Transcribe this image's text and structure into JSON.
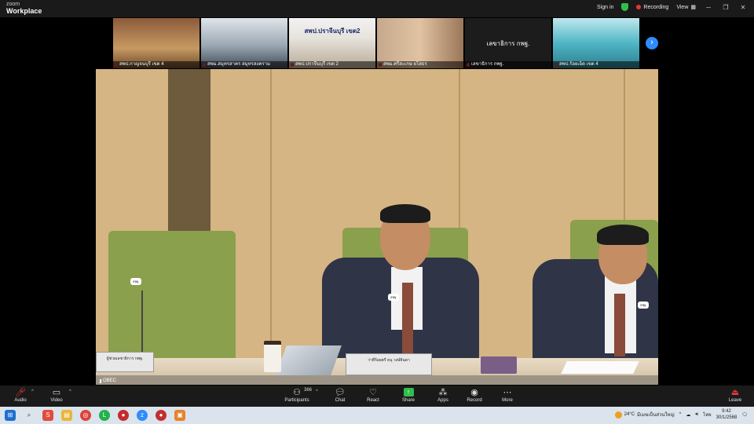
{
  "app": {
    "brand_top": "zoom",
    "brand_bottom": "Workplace"
  },
  "titlebar": {
    "sign_in": "Sign in",
    "recording": "Recording",
    "view": "View",
    "shield_color": "#2fbf4b",
    "recording_color": "#e53935"
  },
  "thumbnails": [
    {
      "label": "สพป.กาญจนบุรี เขต 4"
    },
    {
      "label": "สพม.สมุทรสาคร สมุทรสงคราม"
    },
    {
      "label": "สพป.ปราจีนบุรี เขต 2",
      "caption": "สพป.ปราจีนบุรี เขต2"
    },
    {
      "label": "สพม.ศรีสะเกษ ยโสธร"
    },
    {
      "label": "เลขาธิการ กพฐ.",
      "caption": "เลขาธิการ กพฐ."
    },
    {
      "label": "สพป.ร้อยเอ็ด เขต 4"
    }
  ],
  "main_video": {
    "nameplate_left": "ผู้ช่วยเลขาธิการ กพฐ.",
    "nameplate_center": "ว่าที่ร้อยตรี ธนุ วงษ์จินดา",
    "mic_tag_left": "สพฐ.",
    "mic_tag_center": "สพฐ.",
    "mic_tag_right": "สพฐ.",
    "source_label": "OBEC"
  },
  "toolbar": {
    "audio": "Audio",
    "video": "Video",
    "participants": "Participants",
    "participants_count": "366",
    "chat": "Chat",
    "react": "React",
    "share": "Share",
    "apps": "Apps",
    "record": "Record",
    "more": "More",
    "leave": "Leave",
    "share_color": "#2fbf4b",
    "leave_color": "#e53935"
  },
  "taskbar": {
    "temperature": "24°C",
    "weather_text": "มีเมฆเป็นส่วนใหญ่",
    "language": "ไทย",
    "time": "9:42",
    "date": "30/1/2568"
  }
}
